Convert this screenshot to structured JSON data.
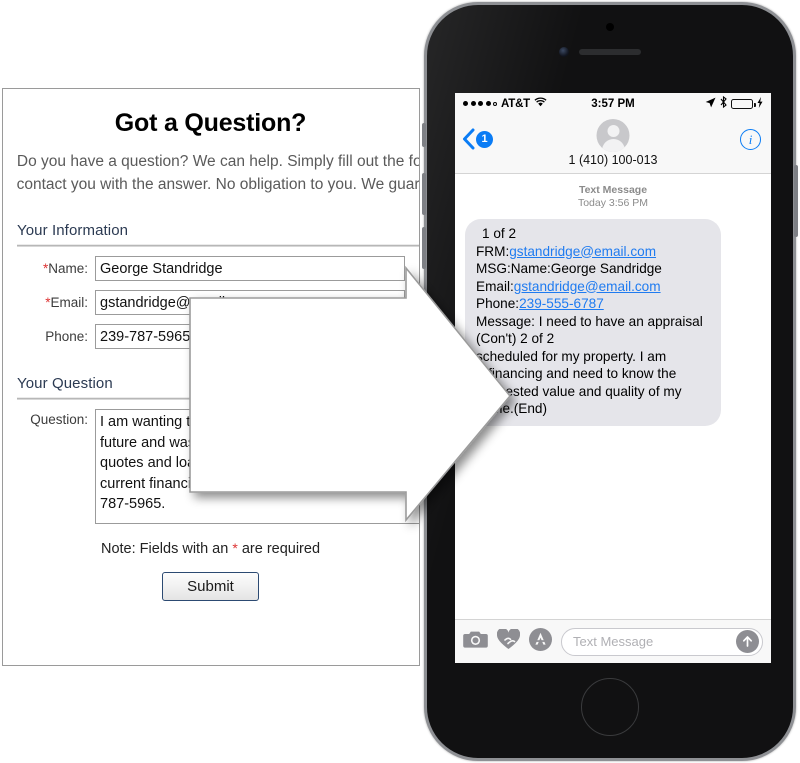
{
  "form": {
    "title": "Got a Question?",
    "intro": "Do you have a question?  We can help.  Simply fill out the form below and we’ll contact you with the answer.  No obligation to you.  We guarantee your privacy.",
    "sections": {
      "info_heading": "Your Information",
      "question_heading": "Your Question"
    },
    "fields": {
      "name_label": "Name:",
      "name_value": "George Standridge",
      "email_label": "Email:",
      "email_value": "gstandridge@email.com",
      "phone_label": "Phone:",
      "phone_value": "239-787-5965",
      "question_label": "Question:",
      "question_value": "I am wanting to refinance my house in the near future and was needing your help with rate quotes and loan programs that would best suit my current financial sitation. Please clal me at 239-787-5965.",
      "required_marker": "*"
    },
    "note": "Note: Fields with an",
    "note_tail": "are required",
    "submit_label": "Submit"
  },
  "phone": {
    "status": {
      "carrier": "AT&T",
      "time": "3:57 PM",
      "signal_dots_filled": 4,
      "signal_dots_total": 5,
      "wifi_icon": "wifi-icon",
      "location_icon": "location-arrow-icon",
      "bluetooth_icon": "bluetooth-icon",
      "battery_icon": "battery-icon",
      "charging_icon": "lightning-bolt-icon",
      "battery_color": "#5ad44f"
    },
    "nav": {
      "back_badge": "1",
      "contact_name": "1 (410) 100-013",
      "info_label": "i"
    },
    "conversation": {
      "meta_type": "Text Message",
      "meta_time": "Today 3:56 PM",
      "message": {
        "line1": "1 of 2",
        "line2_label": "FRM:",
        "line2_link": "gstandridge@email.com",
        "line3": "MSG:Name:George Sandridge",
        "line4_label": "Email:",
        "line4_link": "gstandridge@email.com",
        "line5_label": "Phone:",
        "line5_link": "239-555-6787",
        "line6": "Message: I need to have an appraisal",
        "line7": "(Con't) 2 of 2",
        "line8": "scheduled for my property. I am refinancing and need to know the suggested value and quality of my home.(End)"
      }
    },
    "toolbar": {
      "camera_icon": "camera-icon",
      "digital_touch_icon": "heart-digital-touch-icon",
      "appstore_icon": "app-store-icon",
      "input_placeholder": "Text Message",
      "send_icon": "send-arrow-up-icon"
    },
    "accent_color": "#0a7cf5",
    "bubble_color": "#e5e5ea"
  },
  "arrow": {
    "name": "flow-arrow-right",
    "fill": "#ffffff",
    "stroke": "#9b9b9b"
  }
}
